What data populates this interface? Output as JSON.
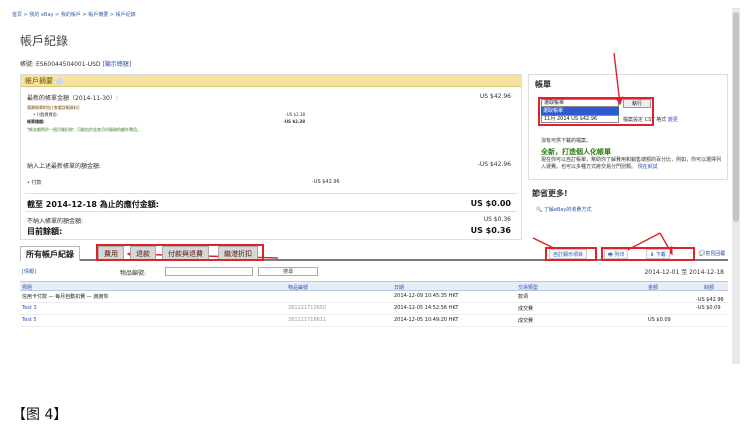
{
  "breadcrumb": "首頁 > 我的 eBay > 我的帳戶 > 帳戶摘要 > 帳戶紀錄",
  "page_title": "帳戶紀錄",
  "account": {
    "label": "帳號:",
    "value": "ES60044504001-USD",
    "link": "[顯示總額]"
  },
  "summary": {
    "title": "帳戶摘要",
    "rows": [
      {
        "label": "最新的帳單金額（2014-11-30）:",
        "value": "US $42.96"
      },
      {
        "label": "電郵帳單附加 [查看詳細資料]",
        "value": ""
      },
      {
        "label": "• 刊登費費用:",
        "value": "-US $2.38"
      },
      {
        "label": "帳單總額:",
        "value": "-US $2.38"
      },
      {
        "label": "納入上述最新帳單的額金額:",
        "value": "-US $42.96"
      },
      {
        "label": "• 付款",
        "mid": "-US $42.96",
        "value": ""
      },
      {
        "label": "截至 2014-12-18 為止的應付金額:",
        "value": "US $0.00"
      },
      {
        "label": "不納入帳單的額金額:",
        "value": "US $0.36"
      },
      {
        "label": "目前餘額:",
        "value": "US $0.36"
      }
    ],
    "note": "*帳金額將於一個月後扣除；可能由於此各月份服務的額外費用。"
  },
  "bill_box": {
    "title": "帳單",
    "select_value": "選取帳單",
    "options": [
      "選取帳單",
      "11月 2014 US $42.96"
    ],
    "go": "執行",
    "csv_prefix": "檔案設定",
    "csv_label": "CSV 格式",
    "csv_link": "變更",
    "note": "沒有可供下載的檔案。",
    "promo_title": "全新，打造個人化帳單",
    "promo_text": "現在你可以自訂帳單，幫助你了解費用和銷售總額的百分比，例如，你可以選擇列入運費。也可以多種方式將交易分門別類。",
    "promo_link": "現在就試"
  },
  "more": {
    "title": "節省更多!",
    "link": "了解eBay的收費方式"
  },
  "tabs": [
    "所有帳戶紀錄",
    "費用",
    "退款",
    "付款與退費",
    "繼港折扣"
  ],
  "tools": [
    "自訂顯示項目",
    "列印",
    "下載",
    "意見回覆"
  ],
  "filter": {
    "label": "物品編號:",
    "button": "搜尋",
    "date_range": "2014-12-01 至 2014-12-18",
    "left": "[情報]"
  },
  "table": {
    "headers": [
      "標題",
      "物品編號",
      "日期",
      "交易類型",
      "金額",
      "餘額"
    ],
    "rows": [
      {
        "title": "信用卡付款 — 每月自動扣費 — 謝謝你",
        "item": "",
        "date": "2014-12-09 10:45:35 HKT",
        "type": "款項",
        "amount": "",
        "balance": "-US $42.96"
      },
      {
        "title": "Test 3",
        "item": "281221712650",
        "date": "2014-12-05 14:52:56 HKT",
        "type": "成交費",
        "amount": "",
        "balance": "-US $0.09"
      },
      {
        "title": "Test 5",
        "item": "281221718611",
        "date": "2014-12-05 10:49:20 HKT",
        "type": "成交費",
        "amount": "US $0.09",
        "balance": ""
      }
    ]
  },
  "caption": "【图 4】"
}
